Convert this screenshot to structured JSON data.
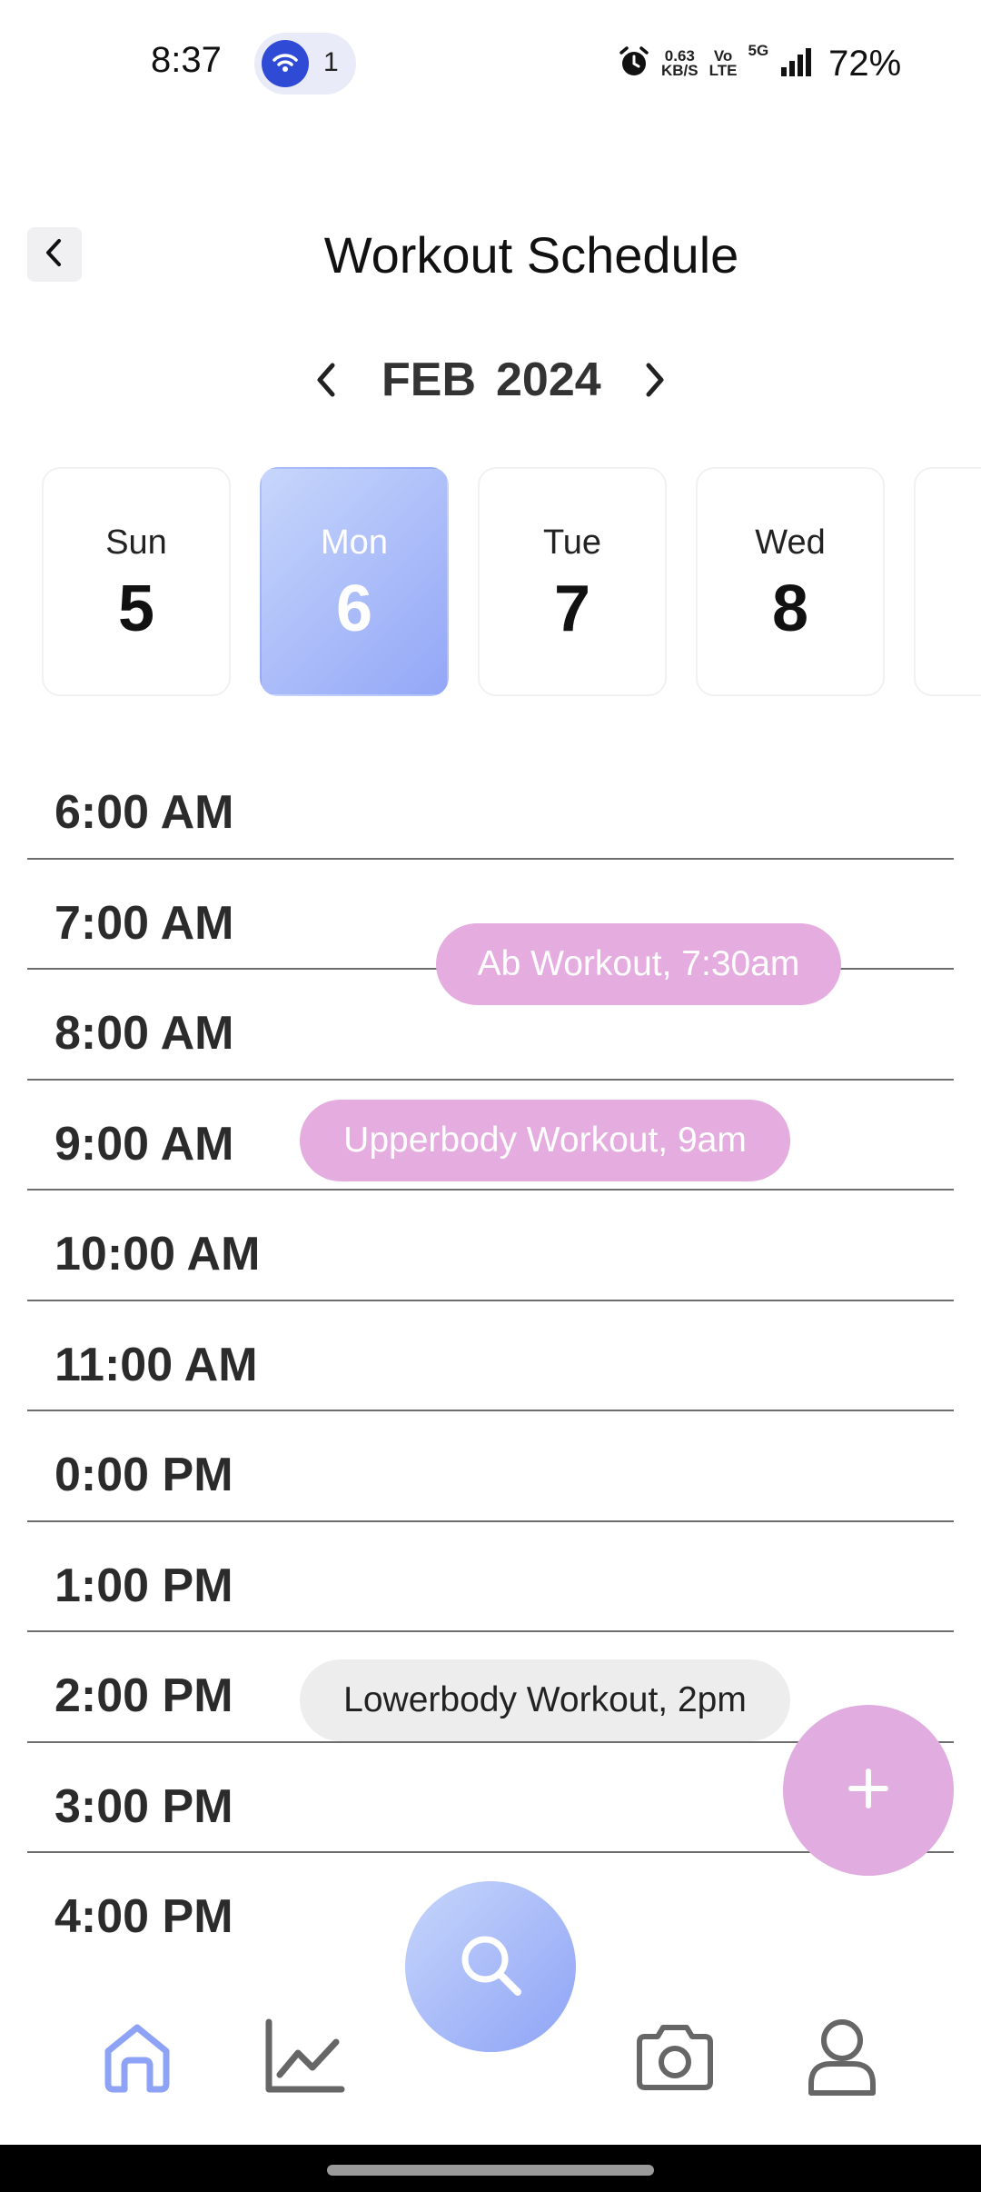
{
  "status_bar": {
    "time": "8:37",
    "hotspot_count": "1",
    "net_speed_value": "0.63",
    "net_speed_unit": "KB/S",
    "volte_top": "Vo",
    "volte_bottom": "LTE",
    "network": "5G",
    "battery": "72%",
    "icons": [
      "hotspot-icon",
      "alarm-icon",
      "signal-icon"
    ]
  },
  "header": {
    "title": "Workout Schedule",
    "back_icon": "chevron-left-icon"
  },
  "month_nav": {
    "month": "FEB",
    "year": "2024",
    "prev_icon": "chevron-left-icon",
    "next_icon": "chevron-right-icon"
  },
  "days": [
    {
      "name": "Sun",
      "number": "5",
      "selected": false
    },
    {
      "name": "Mon",
      "number": "6",
      "selected": true
    },
    {
      "name": "Tue",
      "number": "7",
      "selected": false
    },
    {
      "name": "Wed",
      "number": "8",
      "selected": false
    }
  ],
  "time_slots": [
    "6:00 AM",
    "7:00 AM",
    "8:00 AM",
    "9:00 AM",
    "10:00 AM",
    "11:00 AM",
    "0:00 PM",
    "1:00 PM",
    "2:00 PM",
    "3:00 PM",
    "4:00 PM"
  ],
  "events": [
    {
      "label": "Ab Workout, 7:30am",
      "color": "#e5acdf"
    },
    {
      "label": "Upperbody Workout, 9am",
      "color": "#e5acdf"
    },
    {
      "label": "Lowerbody Workout, 2pm",
      "color": "#ededed"
    }
  ],
  "fab": {
    "icon": "plus-icon",
    "color": "#e1ace0"
  },
  "bottom_nav": {
    "items": [
      "home-icon",
      "chart-icon",
      "search-icon",
      "camera-icon",
      "profile-icon"
    ],
    "active": "home-icon",
    "accent": "#8ea3f6"
  }
}
